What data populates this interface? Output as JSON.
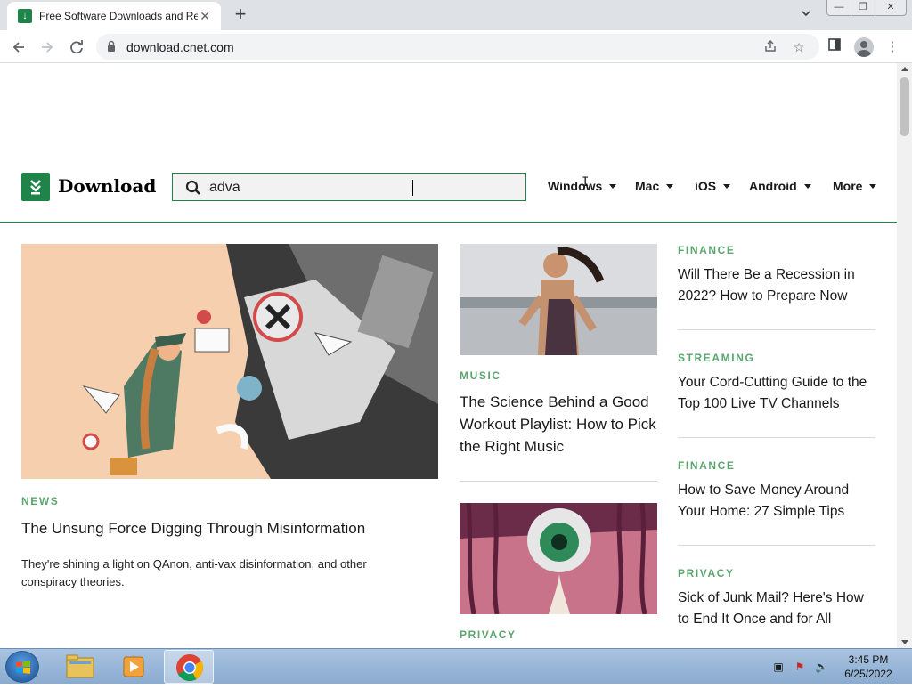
{
  "browser": {
    "tab_title": "Free Software Downloads and Re",
    "url": "download.cnet.com"
  },
  "site": {
    "logo_text": "Download",
    "search_value": "adva",
    "nav": [
      "Windows",
      "Mac",
      "iOS",
      "Android",
      "More"
    ]
  },
  "feature": {
    "category": "NEWS",
    "title": "The Unsung Force Digging Through Misinformation",
    "summary": "They're shining a light on QAnon, anti-vax disinformation, and other conspiracy theories."
  },
  "middle": [
    {
      "category": "MUSIC",
      "title": "The Science Behind a Good Workout Playlist: How to Pick the Right Music"
    },
    {
      "category": "PRIVACY",
      "title": ""
    }
  ],
  "right": [
    {
      "category": "FINANCE",
      "title": "Will There Be a Recession in 2022? How to Prepare Now"
    },
    {
      "category": "STREAMING",
      "title": "Your Cord-Cutting Guide to the Top 100 Live TV Channels"
    },
    {
      "category": "FINANCE",
      "title": "How to Save Money Around Your Home: 27 Simple Tips"
    },
    {
      "category": "PRIVACY",
      "title": "Sick of Junk Mail? Here's How to End It Once and for All"
    }
  ],
  "taskbar": {
    "time": "3:45 PM",
    "date": "6/25/2022"
  },
  "colors": {
    "brand_green": "#1e8449",
    "category_green": "#5ba56e"
  }
}
